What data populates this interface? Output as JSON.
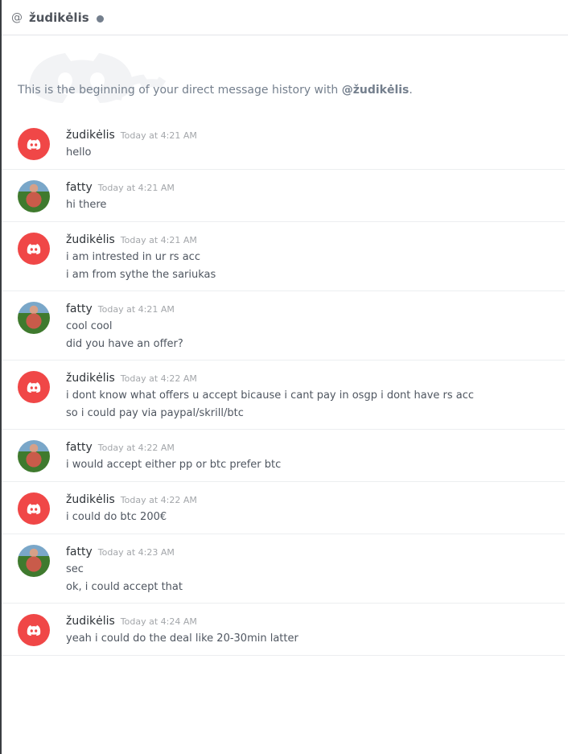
{
  "header": {
    "at_symbol": "@",
    "name": "žudikėlis"
  },
  "intro": {
    "prefix": "This is the beginning of your direct message history with ",
    "handle": "@žudikėlis",
    "suffix": "."
  },
  "messages": [
    {
      "author": "žudikėlis",
      "avatar": "discord-logo-avatar",
      "time": "Today at 4:21 AM",
      "lines": [
        "hello"
      ]
    },
    {
      "author": "fatty",
      "avatar": "photo-avatar",
      "time": "Today at 4:21 AM",
      "lines": [
        "hi there"
      ]
    },
    {
      "author": "žudikėlis",
      "avatar": "discord-logo-avatar",
      "time": "Today at 4:21 AM",
      "lines": [
        "i am intrested in ur rs acc",
        "i am from sythe the sariukas"
      ]
    },
    {
      "author": "fatty",
      "avatar": "photo-avatar",
      "time": "Today at 4:21 AM",
      "lines": [
        "cool cool",
        "did you have an offer?"
      ]
    },
    {
      "author": "žudikėlis",
      "avatar": "discord-logo-avatar",
      "time": "Today at 4:22 AM",
      "lines": [
        "i dont know what offers u accept bicause i cant pay in osgp i dont have rs acc",
        "so i could pay via paypal/skrill/btc"
      ]
    },
    {
      "author": "fatty",
      "avatar": "photo-avatar",
      "time": "Today at 4:22 AM",
      "lines": [
        "i would accept either pp or btc prefer btc"
      ]
    },
    {
      "author": "žudikėlis",
      "avatar": "discord-logo-avatar",
      "time": "Today at 4:22 AM",
      "lines": [
        "i could do btc 200€"
      ]
    },
    {
      "author": "fatty",
      "avatar": "photo-avatar",
      "time": "Today at 4:23 AM",
      "lines": [
        "sec",
        "ok, i could accept that"
      ]
    },
    {
      "author": "žudikėlis",
      "avatar": "discord-logo-avatar",
      "time": "Today at 4:24 AM",
      "lines": [
        "yeah i could do the deal like 20-30min latter"
      ]
    }
  ],
  "colors": {
    "discord_red": "#f04747",
    "status_offline": "#747f8d"
  }
}
